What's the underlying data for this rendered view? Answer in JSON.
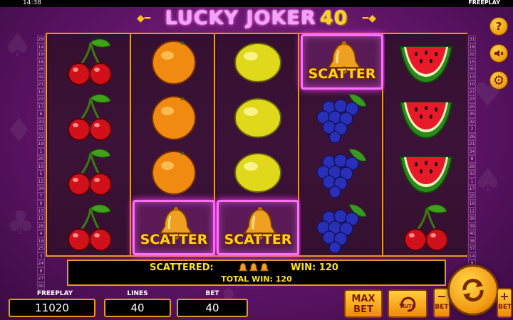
{
  "status_bar": {
    "time": "14:38",
    "mode": "FREEPLAY"
  },
  "title": {
    "main": "LUCKY JOKER",
    "number": "40"
  },
  "reels": [
    [
      "cherry",
      "cherry",
      "cherry",
      "cherry"
    ],
    [
      "orange",
      "orange",
      "orange",
      "bell-scatter"
    ],
    [
      "lemon",
      "lemon",
      "lemon",
      "bell-scatter"
    ],
    [
      "bell-scatter",
      "grapes",
      "grapes",
      "grapes"
    ],
    [
      "watermelon",
      "watermelon",
      "watermelon",
      "cherry"
    ]
  ],
  "highlighted_cells": [
    [
      1,
      3
    ],
    [
      2,
      3
    ],
    [
      3,
      0
    ]
  ],
  "scatter_label": "SCATTER",
  "paylines_left": [
    "29",
    "14",
    "19",
    "16",
    "26",
    "32",
    "21",
    "13",
    "22",
    "17",
    "6",
    "33",
    "31",
    "23",
    "19",
    "1",
    "20",
    "10",
    "5",
    "12",
    "34",
    "7",
    "9",
    "15",
    "11",
    "28",
    "4",
    "18",
    "25",
    "3",
    "24",
    "8",
    "27",
    "30"
  ],
  "paylines_right": [
    "31",
    "18",
    "22",
    "15",
    "30",
    "13",
    "10",
    "27",
    "23",
    "20",
    "35",
    "32",
    "2",
    "26",
    "21",
    "34",
    "8",
    "29",
    "33",
    "1",
    "17",
    "25",
    "16",
    "12",
    "36",
    "39",
    "40",
    "38",
    "37",
    "14",
    "9",
    "3",
    "28",
    "24"
  ],
  "win_panel": {
    "scattered_label": "SCATTERED:",
    "scatter_count": 3,
    "win_label": "WIN: 120",
    "total_win_label": "TOTAL WIN: 120"
  },
  "bottom": {
    "freeplay": {
      "label": "FREEPLAY",
      "value": "11020"
    },
    "lines": {
      "label": "LINES",
      "value": "40"
    },
    "bet": {
      "label": "BET",
      "value": "40"
    },
    "max_bet": {
      "line1": "MAX",
      "line2": "BET"
    },
    "auto": "AUTO",
    "bet_minus": {
      "sign": "−",
      "label": "BET"
    },
    "bet_plus": {
      "sign": "+",
      "label": "BET"
    }
  },
  "side_buttons": [
    "help-icon",
    "sound-off-icon",
    "settings-gear-icon"
  ],
  "colors": {
    "frame": "#e69b1f",
    "accent_yellow": "#ffe31a",
    "highlight": "#ff6dff",
    "background": "#5e1466"
  }
}
